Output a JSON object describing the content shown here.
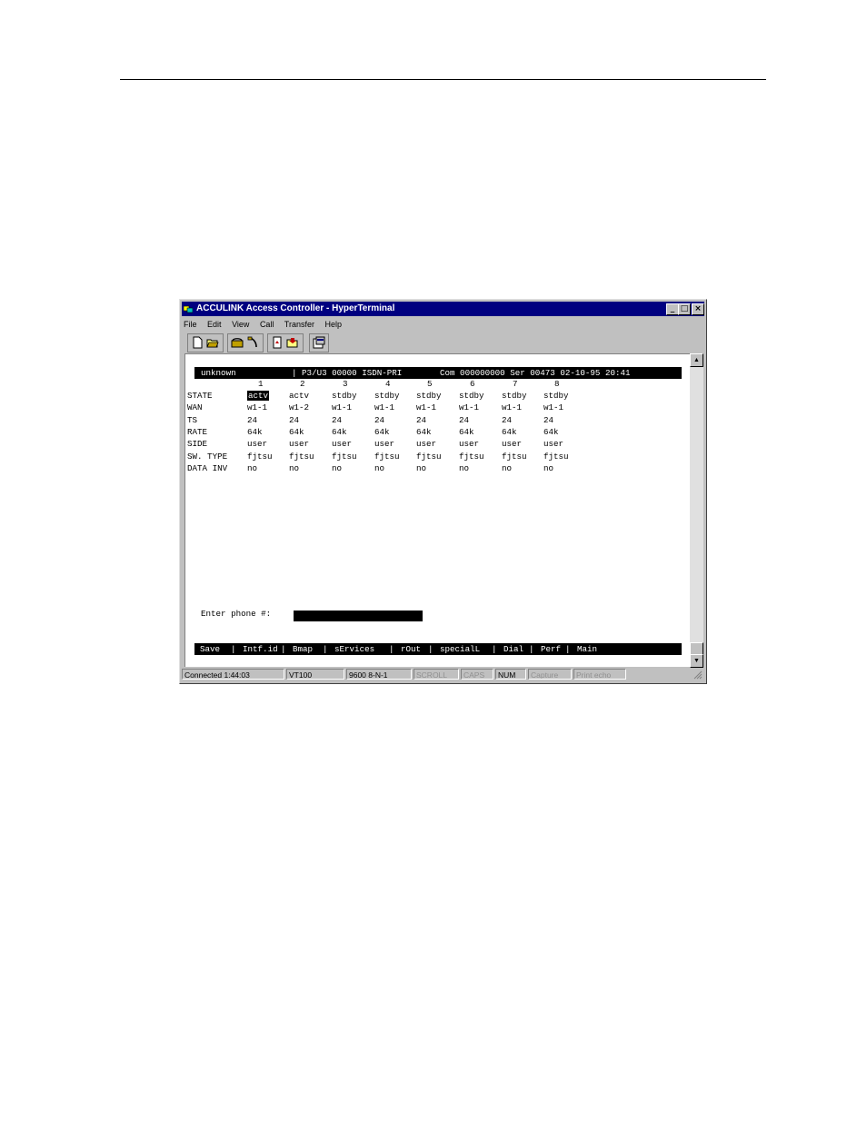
{
  "window": {
    "title": "ACCULINK Access Controller - HyperTerminal",
    "controls": {
      "minimize": "_",
      "maximize": "□",
      "close": "×"
    }
  },
  "menu": [
    "File",
    "Edit",
    "View",
    "Call",
    "Transfer",
    "Help"
  ],
  "toolbar_icons": [
    "new-icon",
    "open-icon",
    "connect-icon",
    "disconnect-icon",
    "send-icon",
    "receive-icon",
    "properties-icon"
  ],
  "terminal": {
    "header": {
      "name": "unknown",
      "slot": "| P3/U3 00000 ISDN-PRI",
      "com": "Com 000000000 Ser 00473 02-10-95 20:41"
    },
    "columns": [
      "1",
      "2",
      "3",
      "4",
      "5",
      "6",
      "7",
      "8"
    ],
    "rows": [
      {
        "label": "STATE",
        "values": [
          "actv",
          "actv",
          "stdby",
          "stdby",
          "stdby",
          "stdby",
          "stdby",
          "stdby"
        ]
      },
      {
        "label": "WAN",
        "values": [
          "w1-1",
          "w1-2",
          "w1-1",
          "w1-1",
          "w1-1",
          "w1-1",
          "w1-1",
          "w1-1"
        ]
      },
      {
        "label": "TS",
        "values": [
          "24",
          "24",
          "24",
          "24",
          "24",
          "24",
          "24",
          "24"
        ]
      },
      {
        "label": "RATE",
        "values": [
          "64k",
          "64k",
          "64k",
          "64k",
          "64k",
          "64k",
          "64k",
          "64k"
        ]
      },
      {
        "label": "SIDE",
        "values": [
          "user",
          "user",
          "user",
          "user",
          "user",
          "user",
          "user",
          "user"
        ]
      },
      {
        "label": "SW. TYPE",
        "values": [
          "fjtsu",
          "fjtsu",
          "fjtsu",
          "fjtsu",
          "fjtsu",
          "fjtsu",
          "fjtsu",
          "fjtsu"
        ]
      },
      {
        "label": "DATA INV",
        "values": [
          "no",
          "no",
          "no",
          "no",
          "no",
          "no",
          "no",
          "no"
        ]
      }
    ],
    "phone_prompt": "Enter phone #:",
    "phone_value": "",
    "commands": [
      "Save",
      "|",
      "Intf.id",
      "|",
      "Bmap",
      "|",
      "sErvices",
      "|",
      "rOut",
      "|",
      "specialL",
      "|",
      "Dial",
      "|",
      "Perf",
      "|",
      "Main"
    ]
  },
  "status": {
    "connected": "Connected 1:44:03",
    "emulation": "VT100",
    "settings": "9600 8-N-1",
    "scroll": "SCROLL",
    "caps": "CAPS",
    "num": "NUM",
    "capture": "Capture",
    "print_echo": "Print echo"
  }
}
